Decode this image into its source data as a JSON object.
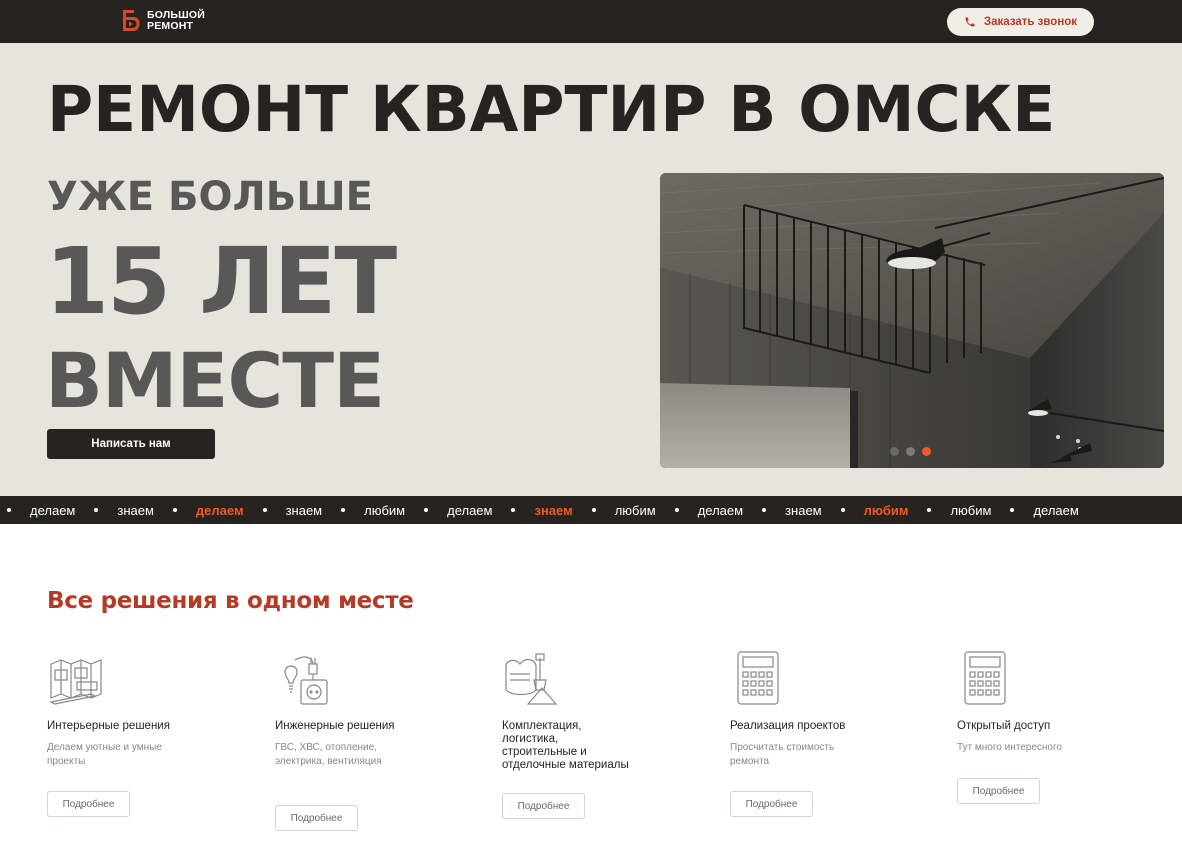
{
  "header": {
    "logo_line1": "БОЛЬШОЙ",
    "logo_line2": "РЕМОНТ",
    "call_label": "Заказать звонок",
    "accent": "#b63a25",
    "call_icon": "phone-icon"
  },
  "hero": {
    "title": "РЕМОНТ КВАРТИР В ОМСКЕ",
    "line1": "УЖЕ БОЛЬШЕ",
    "line2": "15 ЛЕТ",
    "line3": "ВМЕСТЕ",
    "button_label": "Написать нам",
    "slider": {
      "slide_count": 3,
      "active_index": 3,
      "active_color": "#ef5a24"
    }
  },
  "ticker": {
    "items": [
      {
        "text": "делаем",
        "highlight": false
      },
      {
        "text": "знаем",
        "highlight": false
      },
      {
        "text": "делаем",
        "highlight": true
      },
      {
        "text": "знаем",
        "highlight": false
      },
      {
        "text": "любим",
        "highlight": false
      },
      {
        "text": "делаем",
        "highlight": false
      },
      {
        "text": "знаем",
        "highlight": true
      },
      {
        "text": "любим",
        "highlight": false
      },
      {
        "text": "делаем",
        "highlight": false
      },
      {
        "text": "знаем",
        "highlight": false
      },
      {
        "text": "любим",
        "highlight": true
      },
      {
        "text": "любим",
        "highlight": false
      },
      {
        "text": "делаем",
        "highlight": false
      }
    ],
    "highlight_color": "#ef5a24"
  },
  "solutions": {
    "title": "Все решения в одном месте",
    "cards": [
      {
        "icon": "floorplan-icon",
        "title": "Интерьерные решения",
        "desc": "Делаем уютные и умные проекты",
        "button": "Подробнее"
      },
      {
        "icon": "lightbulb-socket-icon",
        "title": "Инженерные решения",
        "desc": "ГВС, ХВС, отопление, электрика, вентиляция",
        "button": "Подробнее"
      },
      {
        "icon": "materials-icon",
        "title": "Комплектация, логистика, строительные и отделочные материалы",
        "desc": "",
        "button": "Подробнее"
      },
      {
        "icon": "calculator-icon",
        "title": "Реализация проектов",
        "desc": "Просчитать стоимость ремонта",
        "button": "Подробнее"
      },
      {
        "icon": "calculator-icon",
        "title": "Открытый доступ",
        "desc": "Тут много интересного",
        "button": "Подробнее"
      }
    ]
  }
}
